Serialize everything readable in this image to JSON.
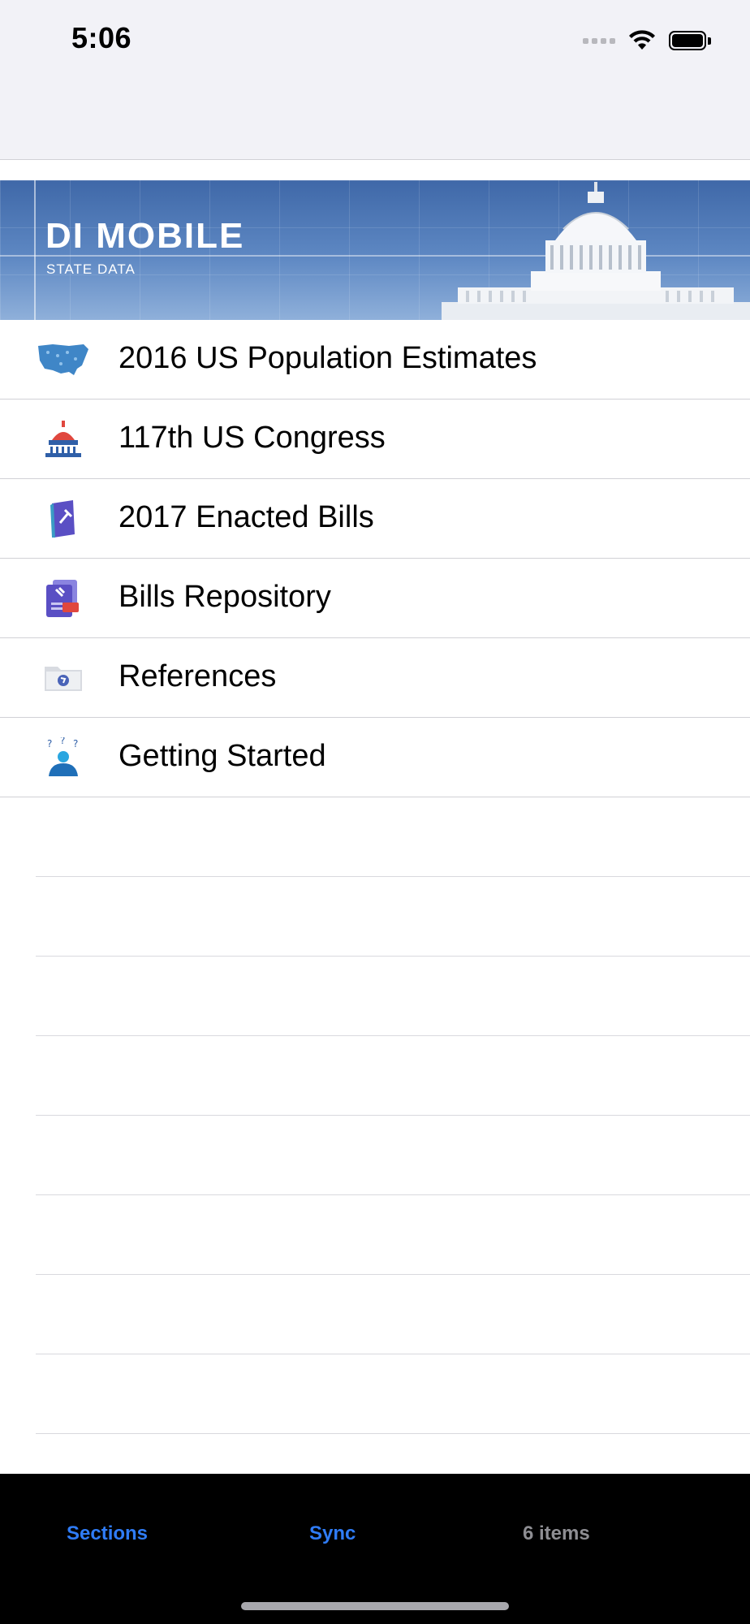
{
  "status_bar": {
    "time": "5:06"
  },
  "banner": {
    "title": "DI MOBILE",
    "subtitle": "STATE DATA"
  },
  "sections": [
    {
      "label": "2016 US Population Estimates",
      "icon": "us-map-icon"
    },
    {
      "label": "117th US Congress",
      "icon": "capitol-icon"
    },
    {
      "label": "2017 Enacted Bills",
      "icon": "law-book-icon"
    },
    {
      "label": "Bills Repository",
      "icon": "pdf-document-icon"
    },
    {
      "label": "References",
      "icon": "folder-globe-icon"
    },
    {
      "label": "Getting Started",
      "icon": "person-question-icon"
    }
  ],
  "toolbar": {
    "sections_label": "Sections",
    "sync_label": "Sync",
    "count_label": "6 items"
  },
  "colors": {
    "accent": "#2f7cf6",
    "toolbar_bg": "#000000",
    "muted_text": "#8e8e93"
  }
}
